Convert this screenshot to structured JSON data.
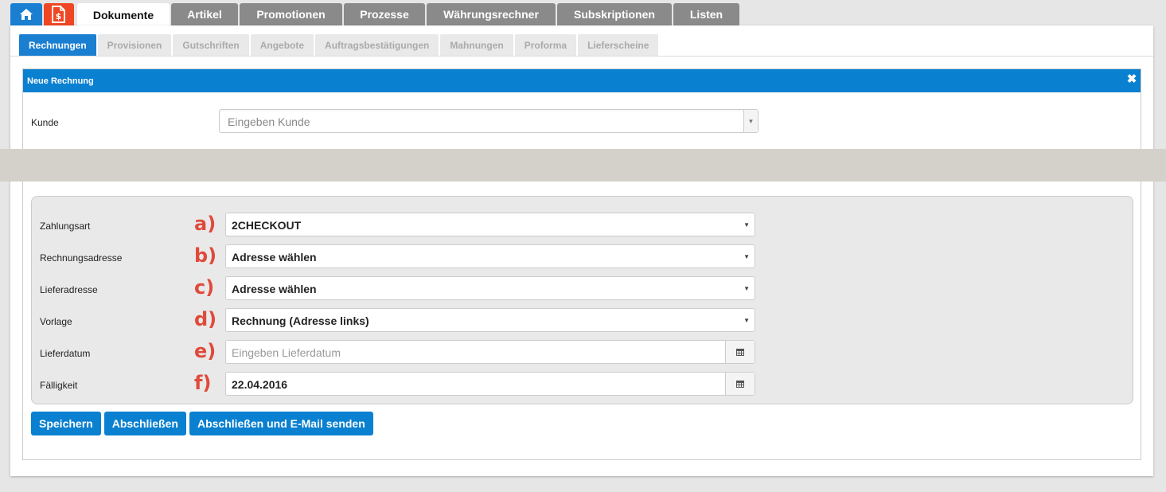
{
  "top_tabs": {
    "items": [
      {
        "label": "Dokumente",
        "active": true
      },
      {
        "label": "Artikel"
      },
      {
        "label": "Promotionen"
      },
      {
        "label": "Prozesse"
      },
      {
        "label": "Währungsrechner"
      },
      {
        "label": "Subskriptionen"
      },
      {
        "label": "Listen"
      }
    ]
  },
  "sub_tabs": {
    "items": [
      {
        "label": "Rechnungen",
        "active": true
      },
      {
        "label": "Provisionen"
      },
      {
        "label": "Gutschriften"
      },
      {
        "label": "Angebote"
      },
      {
        "label": "Auftragsbestätigungen"
      },
      {
        "label": "Mahnungen"
      },
      {
        "label": "Proforma"
      },
      {
        "label": "Lieferscheine"
      }
    ]
  },
  "dialog": {
    "title": "Neue Rechnung",
    "close_icon": "close-icon",
    "kunde": {
      "label": "Kunde",
      "placeholder": "Eingeben Kunde"
    },
    "fields": [
      {
        "label": "Zahlungsart",
        "annotation": "a)",
        "type": "select",
        "value": "2CHECKOUT"
      },
      {
        "label": "Rechnungsadresse",
        "annotation": "b)",
        "type": "select",
        "value": "Adresse wählen"
      },
      {
        "label": "Lieferadresse",
        "annotation": "c)",
        "type": "select",
        "value": "Adresse wählen"
      },
      {
        "label": "Vorlage",
        "annotation": "d)",
        "type": "select",
        "value": "Rechnung (Adresse links)"
      },
      {
        "label": "Lieferdatum",
        "annotation": "e)",
        "type": "date",
        "value": "",
        "placeholder": "Eingeben Lieferdatum"
      },
      {
        "label": "Fälligkeit",
        "annotation": "f)",
        "type": "date",
        "value": "22.04.2016"
      }
    ],
    "buttons": {
      "save": "Speichern",
      "finish": "Abschließen",
      "finish_mail": "Abschließen und E-Mail senden"
    }
  },
  "colors": {
    "primary": "#0a80d0",
    "home_tab": "#1a7fd1",
    "doc_tab": "#ef4723",
    "inactive_tab": "#8a8a8a",
    "annotation": "#e04a3a",
    "band": "#d4d1cb"
  }
}
